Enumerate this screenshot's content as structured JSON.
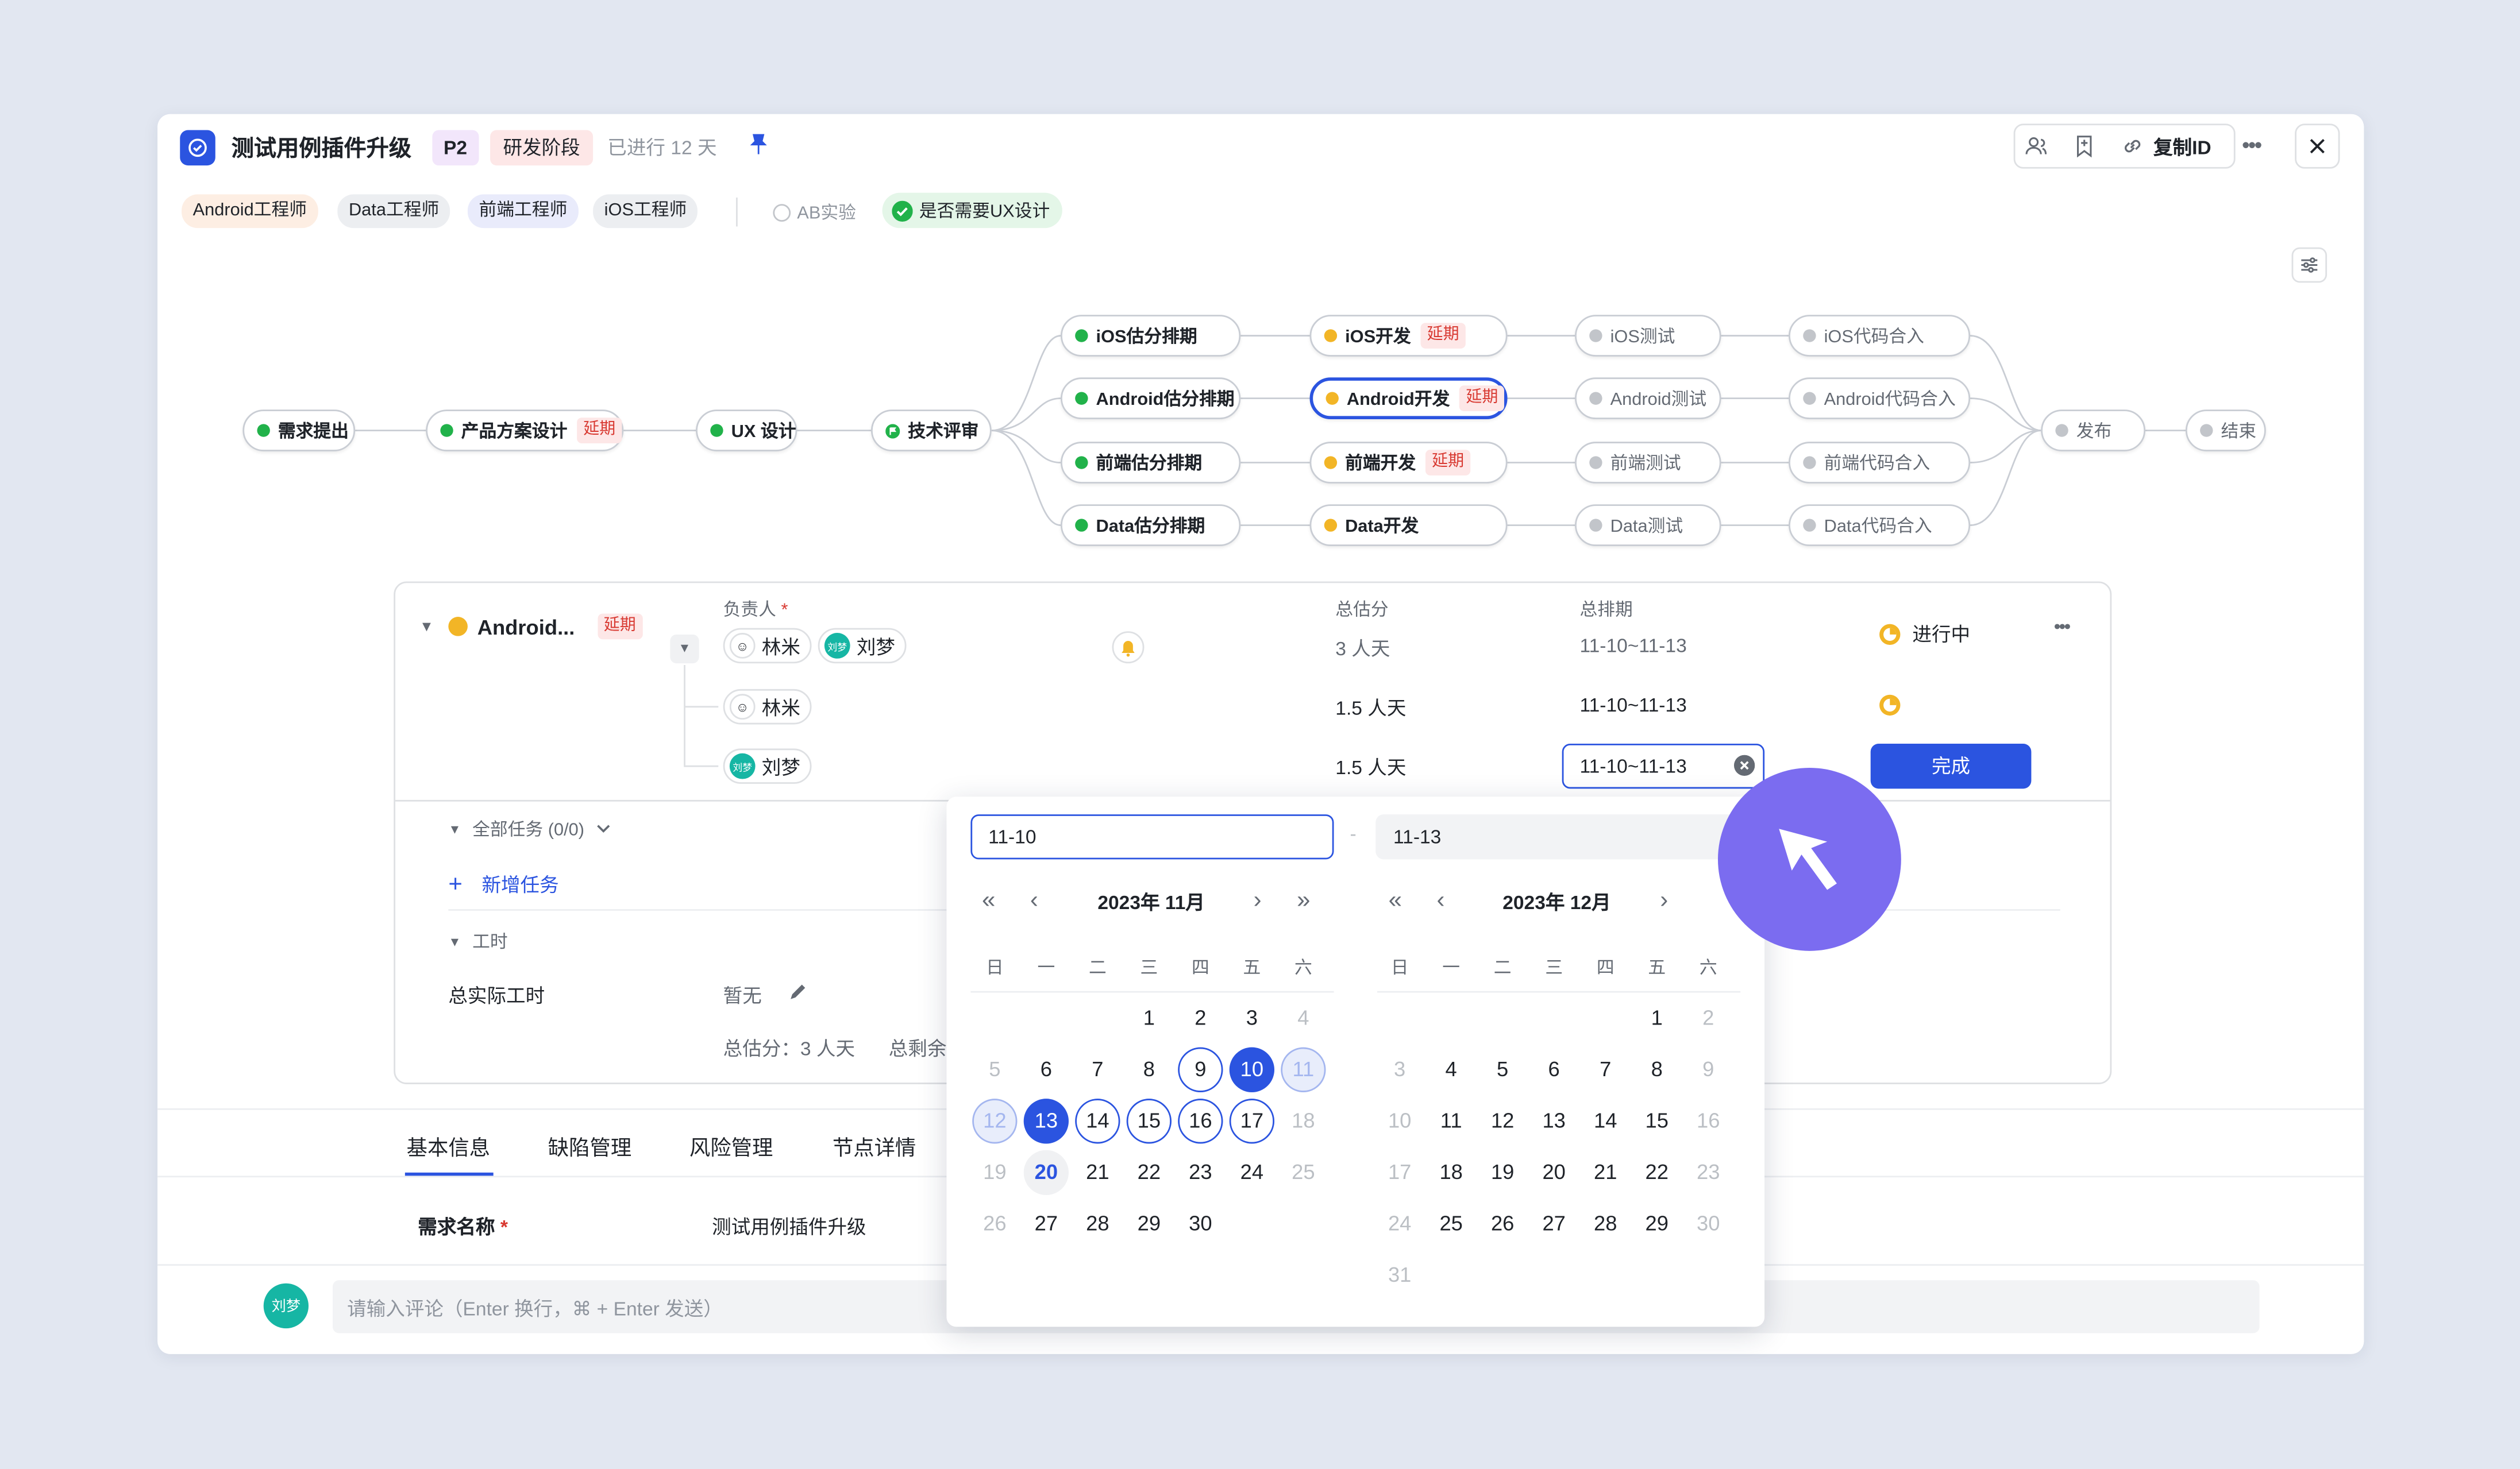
{
  "header": {
    "title": "测试用例插件升级",
    "priority": "P2",
    "stage": "研发阶段",
    "progress_text": "已进行 12 天",
    "copy_id_label": "复制ID"
  },
  "tags": {
    "roles": [
      "Android工程师",
      "Data工程师",
      "前端工程师",
      "iOS工程师"
    ],
    "ab_label": "AB实验",
    "ux_label": "是否需要UX设计"
  },
  "flow": {
    "delay_label": "延期",
    "main": [
      "需求提出",
      "产品方案设计",
      "UX 设计",
      "技术评审"
    ],
    "est": [
      "iOS估分排期",
      "Android估分排期",
      "前端估分排期",
      "Data估分排期"
    ],
    "dev": [
      "iOS开发",
      "Android开发",
      "前端开发",
      "Data开发"
    ],
    "test": [
      "iOS测试",
      "Android测试",
      "前端测试",
      "Data测试"
    ],
    "merge": [
      "iOS代码合入",
      "Android代码合入",
      "前端代码合入",
      "Data代码合入"
    ],
    "release": "发布",
    "end": "结束"
  },
  "detail": {
    "node_name": "Android...",
    "delay_label": "延期",
    "owner_header": "负责人",
    "required_mark": "*",
    "estimate_header": "总估分",
    "schedule_header": "总排期",
    "owners": [
      "林米",
      "刘梦"
    ],
    "avatar_text": "刘梦",
    "total_estimate": "3 人天",
    "total_schedule": "11-10~11-13",
    "status": "进行中",
    "row1_owner": "林米",
    "row1_estimate": "1.5 人天",
    "row1_schedule": "11-10~11-13",
    "row2_owner": "刘梦",
    "row2_estimate": "1.5 人天",
    "row2_schedule": "11-10~11-13",
    "done_button": "完成",
    "all_tasks": "全部任务 (0/0)",
    "add_task": "新增任务",
    "worktime": "工时",
    "actual_worktime_label": "总实际工时",
    "actual_worktime_value": "暂无",
    "summary_estimate": "总估分：3 人天",
    "summary_remaining": "总剩余"
  },
  "tabs": [
    "基本信息",
    "缺陷管理",
    "风险管理",
    "节点详情"
  ],
  "form": {
    "name_label": "需求名称",
    "required_mark": "*",
    "name_value": "测试用例插件升级"
  },
  "comment": {
    "avatar_text": "刘梦",
    "placeholder": "请输入评论（Enter 换行，⌘ + Enter 发送）"
  },
  "datepicker": {
    "start_value": "11-10",
    "end_value": "11-13",
    "separator": "-",
    "weekdays": [
      "日",
      "一",
      "二",
      "三",
      "四",
      "五",
      "六"
    ],
    "left": {
      "title": "2023年 11月",
      "weeks": [
        [
          "",
          "",
          "",
          "1",
          "2",
          "3",
          "4"
        ],
        [
          "5",
          "6",
          "7",
          "8",
          "9",
          "10",
          "11"
        ],
        [
          "12",
          "13",
          "14",
          "15",
          "16",
          "17",
          "18"
        ],
        [
          "19",
          "20",
          "21",
          "22",
          "23",
          "24",
          "25"
        ],
        [
          "26",
          "27",
          "28",
          "29",
          "30",
          "",
          ""
        ]
      ]
    },
    "right": {
      "title": "2023年 12月",
      "weeks": [
        [
          "",
          "",
          "",
          "",
          "",
          "1",
          "2"
        ],
        [
          "3",
          "4",
          "5",
          "6",
          "7",
          "8",
          "9"
        ],
        [
          "10",
          "11",
          "12",
          "13",
          "14",
          "15",
          "16"
        ],
        [
          "17",
          "18",
          "19",
          "20",
          "21",
          "22",
          "23"
        ],
        [
          "24",
          "25",
          "26",
          "27",
          "28",
          "29",
          "30"
        ],
        [
          "31",
          "",
          "",
          "",
          "",
          "",
          ""
        ]
      ]
    }
  },
  "colors": {
    "accent": "#2b54e0",
    "delay_bg": "#fde7e7",
    "delay_text": "#d83931",
    "cursor": "#7b6cf0",
    "done_green": "#21b24a",
    "in_progress": "#f2b526"
  }
}
